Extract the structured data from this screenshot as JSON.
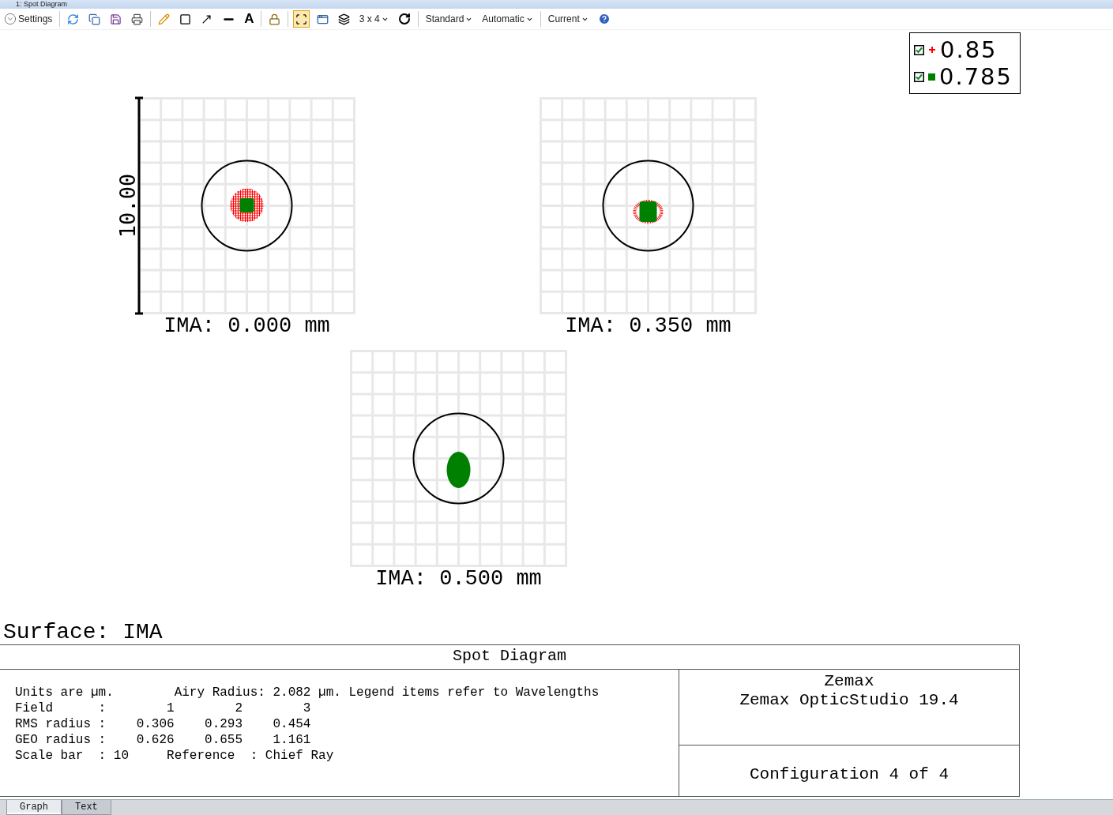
{
  "window": {
    "title": "1: Spot Diagram"
  },
  "toolbar": {
    "settings": "Settings",
    "text_tool": "A",
    "fit_selected": true,
    "layout": "3 x 4",
    "dropdowns": [
      "Standard",
      "Automatic",
      "Current"
    ]
  },
  "legend": [
    {
      "label": "0.85",
      "color": "#ff0000",
      "checked": true,
      "kind": "cross"
    },
    {
      "label": "0.785",
      "color": "#008000",
      "checked": true,
      "kind": "square"
    }
  ],
  "plots": [
    {
      "label": "IMA: 0.000 mm",
      "scale_label": "10.00"
    },
    {
      "label": "IMA: 0.350 mm"
    },
    {
      "label": "IMA: 0.500 mm"
    }
  ],
  "surface": "Surface: IMA",
  "footer": {
    "title": "Spot Diagram",
    "lines": [
      "Units are µm.        Airy Radius: 2.082 µm. Legend items refer to Wavelengths",
      "Field      :        1        2        3",
      "RMS radius :    0.306    0.293    0.454",
      "GEO radius :    0.626    0.655    1.161",
      "Scale bar  : 10     Reference  : Chief Ray"
    ],
    "company": "Zemax",
    "product": "Zemax OpticStudio 19.4",
    "configuration": "Configuration 4 of 4"
  },
  "tabs": [
    {
      "label": "Graph",
      "selected": true
    },
    {
      "label": "Text",
      "selected": false
    }
  ]
}
